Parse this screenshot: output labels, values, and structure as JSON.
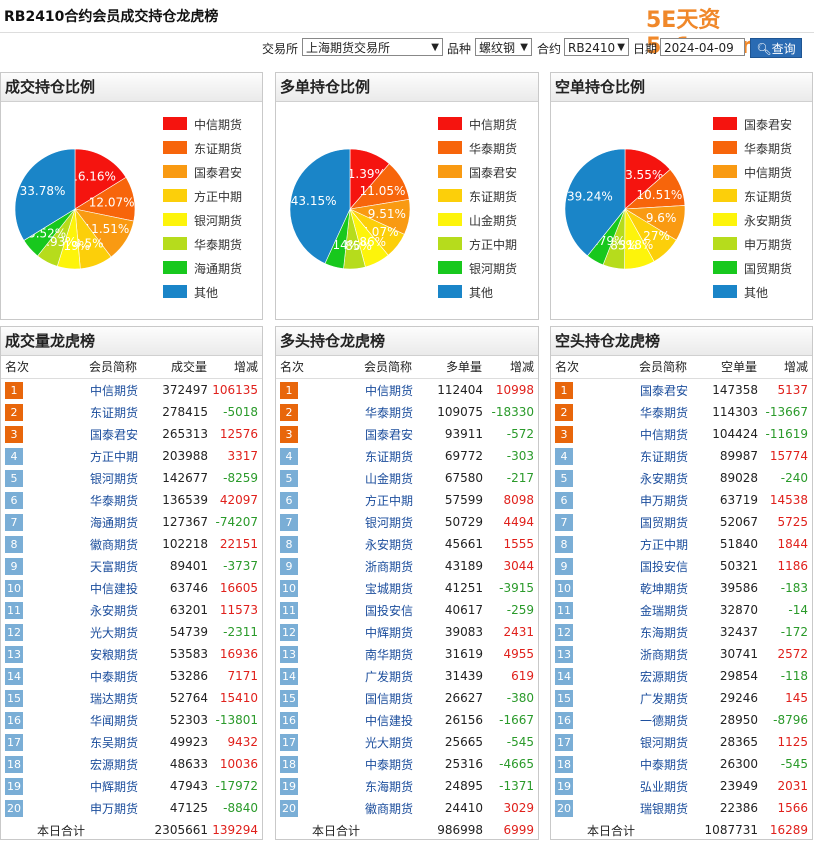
{
  "title": "RB2410合约会员成交持仓龙虎榜",
  "brand": "5E天资5e1z.com",
  "filters": {
    "exchange_label": "交易所",
    "exchange_value": "上海期货交易所",
    "product_label": "品种",
    "product_value": "螺纹钢",
    "contract_label": "合约",
    "contract_value": "RB2410",
    "date_label": "日期",
    "date_value": "2024-04-09",
    "query_label": "查询"
  },
  "colors": {
    "slices": [
      "#f5140f",
      "#f7650b",
      "#f99a12",
      "#fccf0a",
      "#fdf40b",
      "#b6dc1c",
      "#18c81d",
      "#1a85c8"
    ],
    "rank_top": "#e8660b",
    "rank_normal": "#7aaed6",
    "positive": "#e0201b",
    "negative": "#2a9a2a"
  },
  "pies": [
    {
      "title": "成交持仓比例",
      "legend": [
        "中信期货",
        "东证期货",
        "国泰君安",
        "方正中期",
        "银河期货",
        "华泰期货",
        "海通期货",
        "其他"
      ],
      "values": [
        16.16,
        12.07,
        11.51,
        8.85,
        6.19,
        5.93,
        5.52,
        33.78
      ],
      "labels": [
        "16.16%",
        "12.07%",
        "11.51%",
        "8.5%",
        "6.19%",
        "5.93%",
        "5.52%",
        "33.78%"
      ]
    },
    {
      "title": "多单持仓比例",
      "legend": [
        "中信期货",
        "华泰期货",
        "国泰君安",
        "东证期货",
        "山金期货",
        "方正中期",
        "银河期货",
        "其他"
      ],
      "values": [
        11.39,
        11.05,
        9.51,
        7.07,
        6.86,
        5.85,
        5.14,
        43.15
      ],
      "labels": [
        "11.39%",
        "11.05%",
        "9.51%",
        "7.07%",
        "6.86%",
        "5.85%",
        "5.14%",
        "43.15%"
      ]
    },
    {
      "title": "空单持仓比例",
      "legend": [
        "国泰君安",
        "华泰期货",
        "中信期货",
        "东证期货",
        "永安期货",
        "申万期货",
        "国贸期货",
        "其他"
      ],
      "values": [
        13.55,
        10.51,
        9.6,
        8.27,
        8.18,
        5.85,
        4.79,
        39.24
      ],
      "labels": [
        "13.55%",
        "10.51%",
        "9.6%",
        "8.27%",
        "8.18%",
        "5.85%",
        "4.79%",
        "39.24%"
      ]
    }
  ],
  "tables": [
    {
      "title": "成交量龙虎榜",
      "headers": [
        "名次",
        "会员简称",
        "成交量",
        "增减"
      ],
      "rows": [
        [
          "1",
          "中信期货",
          "372497",
          "106135"
        ],
        [
          "2",
          "东证期货",
          "278415",
          "-5018"
        ],
        [
          "3",
          "国泰君安",
          "265313",
          "12576"
        ],
        [
          "4",
          "方正中期",
          "203988",
          "3317"
        ],
        [
          "5",
          "银河期货",
          "142677",
          "-8259"
        ],
        [
          "6",
          "华泰期货",
          "136539",
          "42097"
        ],
        [
          "7",
          "海通期货",
          "127367",
          "-74207"
        ],
        [
          "8",
          "徽商期货",
          "102218",
          "22151"
        ],
        [
          "9",
          "天富期货",
          "89401",
          "-3737"
        ],
        [
          "10",
          "中信建投",
          "63746",
          "16605"
        ],
        [
          "11",
          "永安期货",
          "63201",
          "11573"
        ],
        [
          "12",
          "光大期货",
          "54739",
          "-2311"
        ],
        [
          "13",
          "安粮期货",
          "53583",
          "16936"
        ],
        [
          "14",
          "中泰期货",
          "53286",
          "7171"
        ],
        [
          "15",
          "瑞达期货",
          "52764",
          "15410"
        ],
        [
          "16",
          "华闻期货",
          "52303",
          "-13801"
        ],
        [
          "17",
          "东吴期货",
          "49923",
          "9432"
        ],
        [
          "18",
          "宏源期货",
          "48633",
          "10036"
        ],
        [
          "19",
          "中辉期货",
          "47943",
          "-17972"
        ],
        [
          "20",
          "申万期货",
          "47125",
          "-8840"
        ]
      ],
      "sum_label": "本日合计",
      "sum_value": "2305661",
      "sum_change": "139294"
    },
    {
      "title": "多头持仓龙虎榜",
      "headers": [
        "名次",
        "会员简称",
        "多单量",
        "增减"
      ],
      "rows": [
        [
          "1",
          "中信期货",
          "112404",
          "10998"
        ],
        [
          "2",
          "华泰期货",
          "109075",
          "-18330"
        ],
        [
          "3",
          "国泰君安",
          "93911",
          "-572"
        ],
        [
          "4",
          "东证期货",
          "69772",
          "-303"
        ],
        [
          "5",
          "山金期货",
          "67580",
          "-217"
        ],
        [
          "6",
          "方正中期",
          "57599",
          "8098"
        ],
        [
          "7",
          "银河期货",
          "50729",
          "4494"
        ],
        [
          "8",
          "永安期货",
          "45661",
          "1555"
        ],
        [
          "9",
          "浙商期货",
          "43189",
          "3044"
        ],
        [
          "10",
          "宝城期货",
          "41251",
          "-3915"
        ],
        [
          "11",
          "国投安信",
          "40617",
          "-259"
        ],
        [
          "12",
          "中辉期货",
          "39083",
          "2431"
        ],
        [
          "13",
          "南华期货",
          "31619",
          "4955"
        ],
        [
          "14",
          "广发期货",
          "31439",
          "619"
        ],
        [
          "15",
          "国信期货",
          "26627",
          "-380"
        ],
        [
          "16",
          "中信建投",
          "26156",
          "-1667"
        ],
        [
          "17",
          "光大期货",
          "25665",
          "-545"
        ],
        [
          "18",
          "中泰期货",
          "25316",
          "-4665"
        ],
        [
          "19",
          "东海期货",
          "24895",
          "-1371"
        ],
        [
          "20",
          "徽商期货",
          "24410",
          "3029"
        ]
      ],
      "sum_label": "本日合计",
      "sum_value": "986998",
      "sum_change": "6999"
    },
    {
      "title": "空头持仓龙虎榜",
      "headers": [
        "名次",
        "会员简称",
        "空单量",
        "增减"
      ],
      "rows": [
        [
          "1",
          "国泰君安",
          "147358",
          "5137"
        ],
        [
          "2",
          "华泰期货",
          "114303",
          "-13667"
        ],
        [
          "3",
          "中信期货",
          "104424",
          "-11619"
        ],
        [
          "4",
          "东证期货",
          "89987",
          "15774"
        ],
        [
          "5",
          "永安期货",
          "89028",
          "-240"
        ],
        [
          "6",
          "申万期货",
          "63719",
          "14538"
        ],
        [
          "7",
          "国贸期货",
          "52067",
          "5725"
        ],
        [
          "8",
          "方正中期",
          "51840",
          "1844"
        ],
        [
          "9",
          "国投安信",
          "50321",
          "1186"
        ],
        [
          "10",
          "乾坤期货",
          "39586",
          "-183"
        ],
        [
          "11",
          "金瑞期货",
          "32870",
          "-14"
        ],
        [
          "12",
          "东海期货",
          "32437",
          "-172"
        ],
        [
          "13",
          "浙商期货",
          "30741",
          "2572"
        ],
        [
          "14",
          "宏源期货",
          "29854",
          "-118"
        ],
        [
          "15",
          "广发期货",
          "29246",
          "145"
        ],
        [
          "16",
          "一德期货",
          "28950",
          "-8796"
        ],
        [
          "17",
          "银河期货",
          "28365",
          "1125"
        ],
        [
          "18",
          "中泰期货",
          "26300",
          "-545"
        ],
        [
          "19",
          "弘业期货",
          "23949",
          "2031"
        ],
        [
          "20",
          "瑞银期货",
          "22386",
          "1566"
        ]
      ],
      "sum_label": "本日合计",
      "sum_value": "1087731",
      "sum_change": "16289"
    }
  ]
}
